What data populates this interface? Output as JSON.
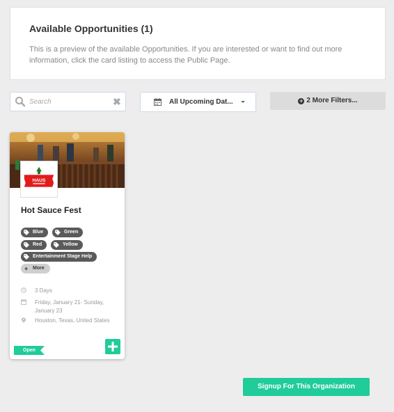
{
  "header": {
    "title": "Available Opportunities (1)",
    "description": "This is a preview of the available Opportunities. If you are interested or want to find out more information, click the card listing to access the Public Page."
  },
  "filters": {
    "search_placeholder": "Search",
    "search_value": "",
    "date_label": "All Upcoming Dat...",
    "more_filters_label": "2 More Filters..."
  },
  "card": {
    "logo_text": "HAUS",
    "title": "Hot Sauce Fest",
    "tags": [
      "Blue",
      "Green",
      "Red",
      "Yellow",
      "Entertainment Stage Help"
    ],
    "more_label": "More",
    "duration": "3 Days",
    "dates": "Friday, January 21- Sunday, January 23",
    "location": "Houston, Texas, United States",
    "status": "Open"
  },
  "signup_label": "Signup For This Organization",
  "colors": {
    "accent": "#1fcc9a",
    "tag_bg": "#5a5a5a",
    "page_bg": "#ededed"
  }
}
